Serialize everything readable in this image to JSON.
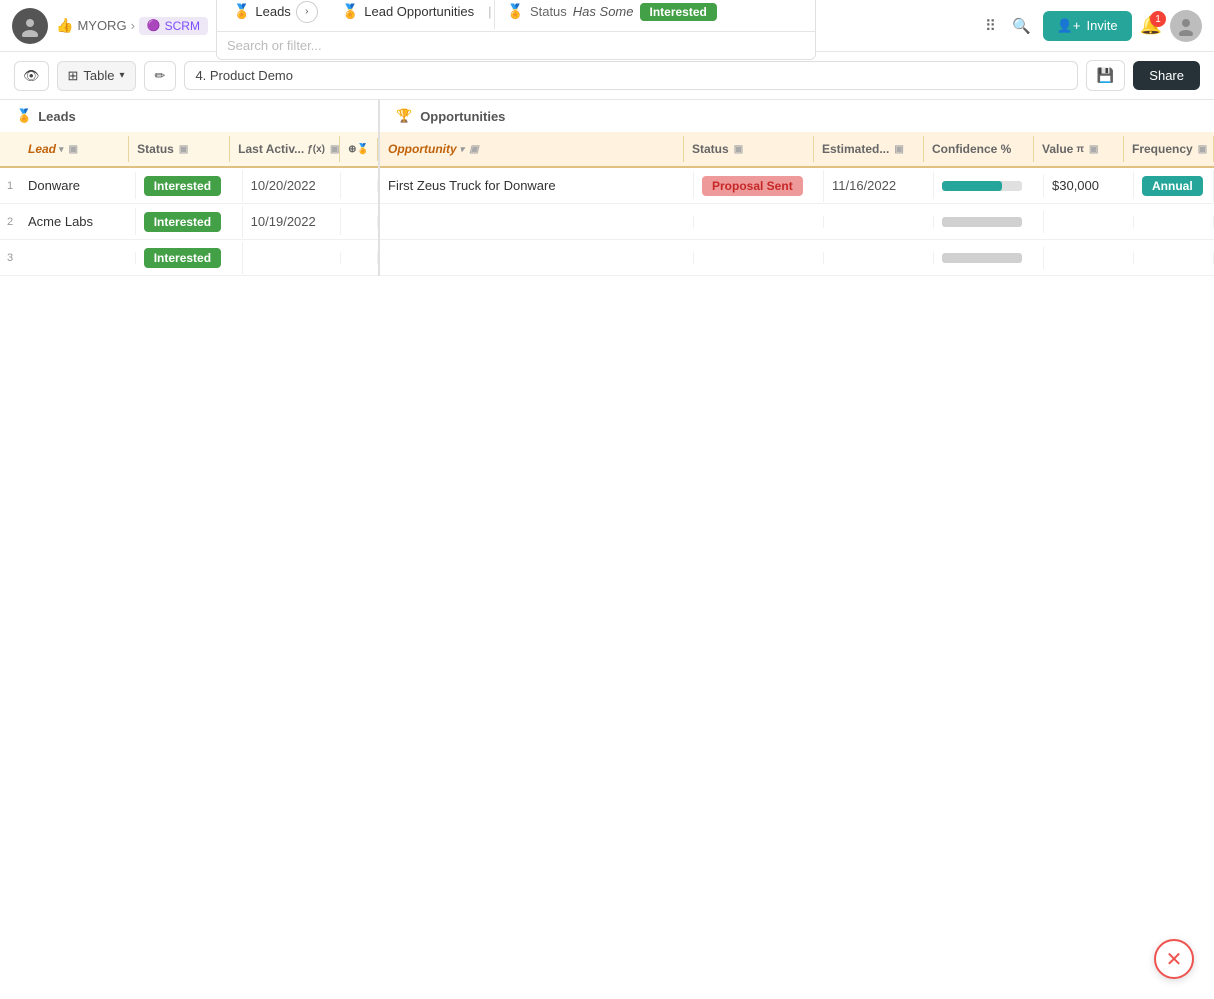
{
  "nav": {
    "org": "MYORG",
    "app": "SCRM",
    "breadcrumb": {
      "leads_label": "Leads",
      "lead_opps_label": "Lead Opportunities",
      "status_label": "Status",
      "has_some_label": "Has Some",
      "interested_label": "Interested"
    },
    "search_placeholder": "Search or filter...",
    "invite_label": "Invite",
    "notif_count": "1"
  },
  "toolbar": {
    "table_label": "Table",
    "stage_value": "4. Product Demo",
    "share_label": "Share"
  },
  "left_section": {
    "title": "Leads"
  },
  "right_section": {
    "title": "Opportunities"
  },
  "left_headers": [
    {
      "label": "Lead",
      "has_sort": true,
      "has_filter": true
    },
    {
      "label": "Status",
      "has_sort": false,
      "has_filter": true
    },
    {
      "label": "Last Activ...",
      "has_sort": false,
      "has_filter": true
    },
    {
      "label": "",
      "has_sort": false,
      "has_filter": false
    }
  ],
  "right_headers": [
    {
      "label": "Opportunity",
      "has_sort": true,
      "has_filter": true
    },
    {
      "label": "Status",
      "has_sort": false,
      "has_filter": true
    },
    {
      "label": "Estimated...",
      "has_sort": false,
      "has_filter": true
    },
    {
      "label": "Confidence %",
      "has_sort": false,
      "has_filter": false
    },
    {
      "label": "Value",
      "has_sort": false,
      "has_filter": true
    },
    {
      "label": "Frequency",
      "has_sort": false,
      "has_filter": true
    }
  ],
  "rows": [
    {
      "num": "1",
      "lead": "Donware",
      "status": "Interested",
      "activity": "10/20/2022",
      "opportunity": "First Zeus Truck for Donware",
      "opp_status": "Proposal Sent",
      "estimated": "11/16/2022",
      "confidence_pct": 75,
      "value": "$30,000",
      "frequency": "Annual",
      "has_confidence_bar": true,
      "has_freq_badge": true
    },
    {
      "num": "2",
      "lead": "Acme Labs",
      "status": "Interested",
      "activity": "10/19/2022",
      "opportunity": "",
      "opp_status": "",
      "estimated": "",
      "confidence_pct": 0,
      "value": "",
      "frequency": "",
      "has_confidence_bar": false,
      "has_freq_badge": false
    },
    {
      "num": "3",
      "lead": "",
      "status": "Interested",
      "activity": "",
      "opportunity": "",
      "opp_status": "",
      "estimated": "",
      "confidence_pct": 0,
      "value": "",
      "frequency": "",
      "has_confidence_bar": false,
      "has_freq_badge": false
    }
  ]
}
